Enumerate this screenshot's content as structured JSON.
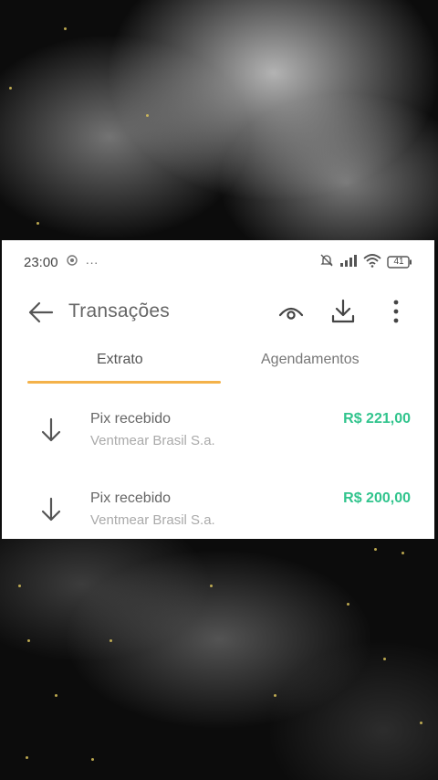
{
  "statusbar": {
    "time": "23:00",
    "dots": "···",
    "battery": "41"
  },
  "header": {
    "title": "Transações"
  },
  "tabs": [
    {
      "label": "Extrato",
      "active": true
    },
    {
      "label": "Agendamentos",
      "active": false
    }
  ],
  "transactions": [
    {
      "title": "Pix recebido",
      "subtitle": "Ventmear Brasil S.a.",
      "amount": "R$ 221,00",
      "icon": "arrow-down-icon"
    },
    {
      "title": "Pix recebido",
      "subtitle": "Ventmear Brasil S.a.",
      "amount": "R$ 200,00",
      "icon": "arrow-down-icon"
    }
  ],
  "colors": {
    "accent_tab": "#f4b24a",
    "amount_green": "#31c48d"
  }
}
